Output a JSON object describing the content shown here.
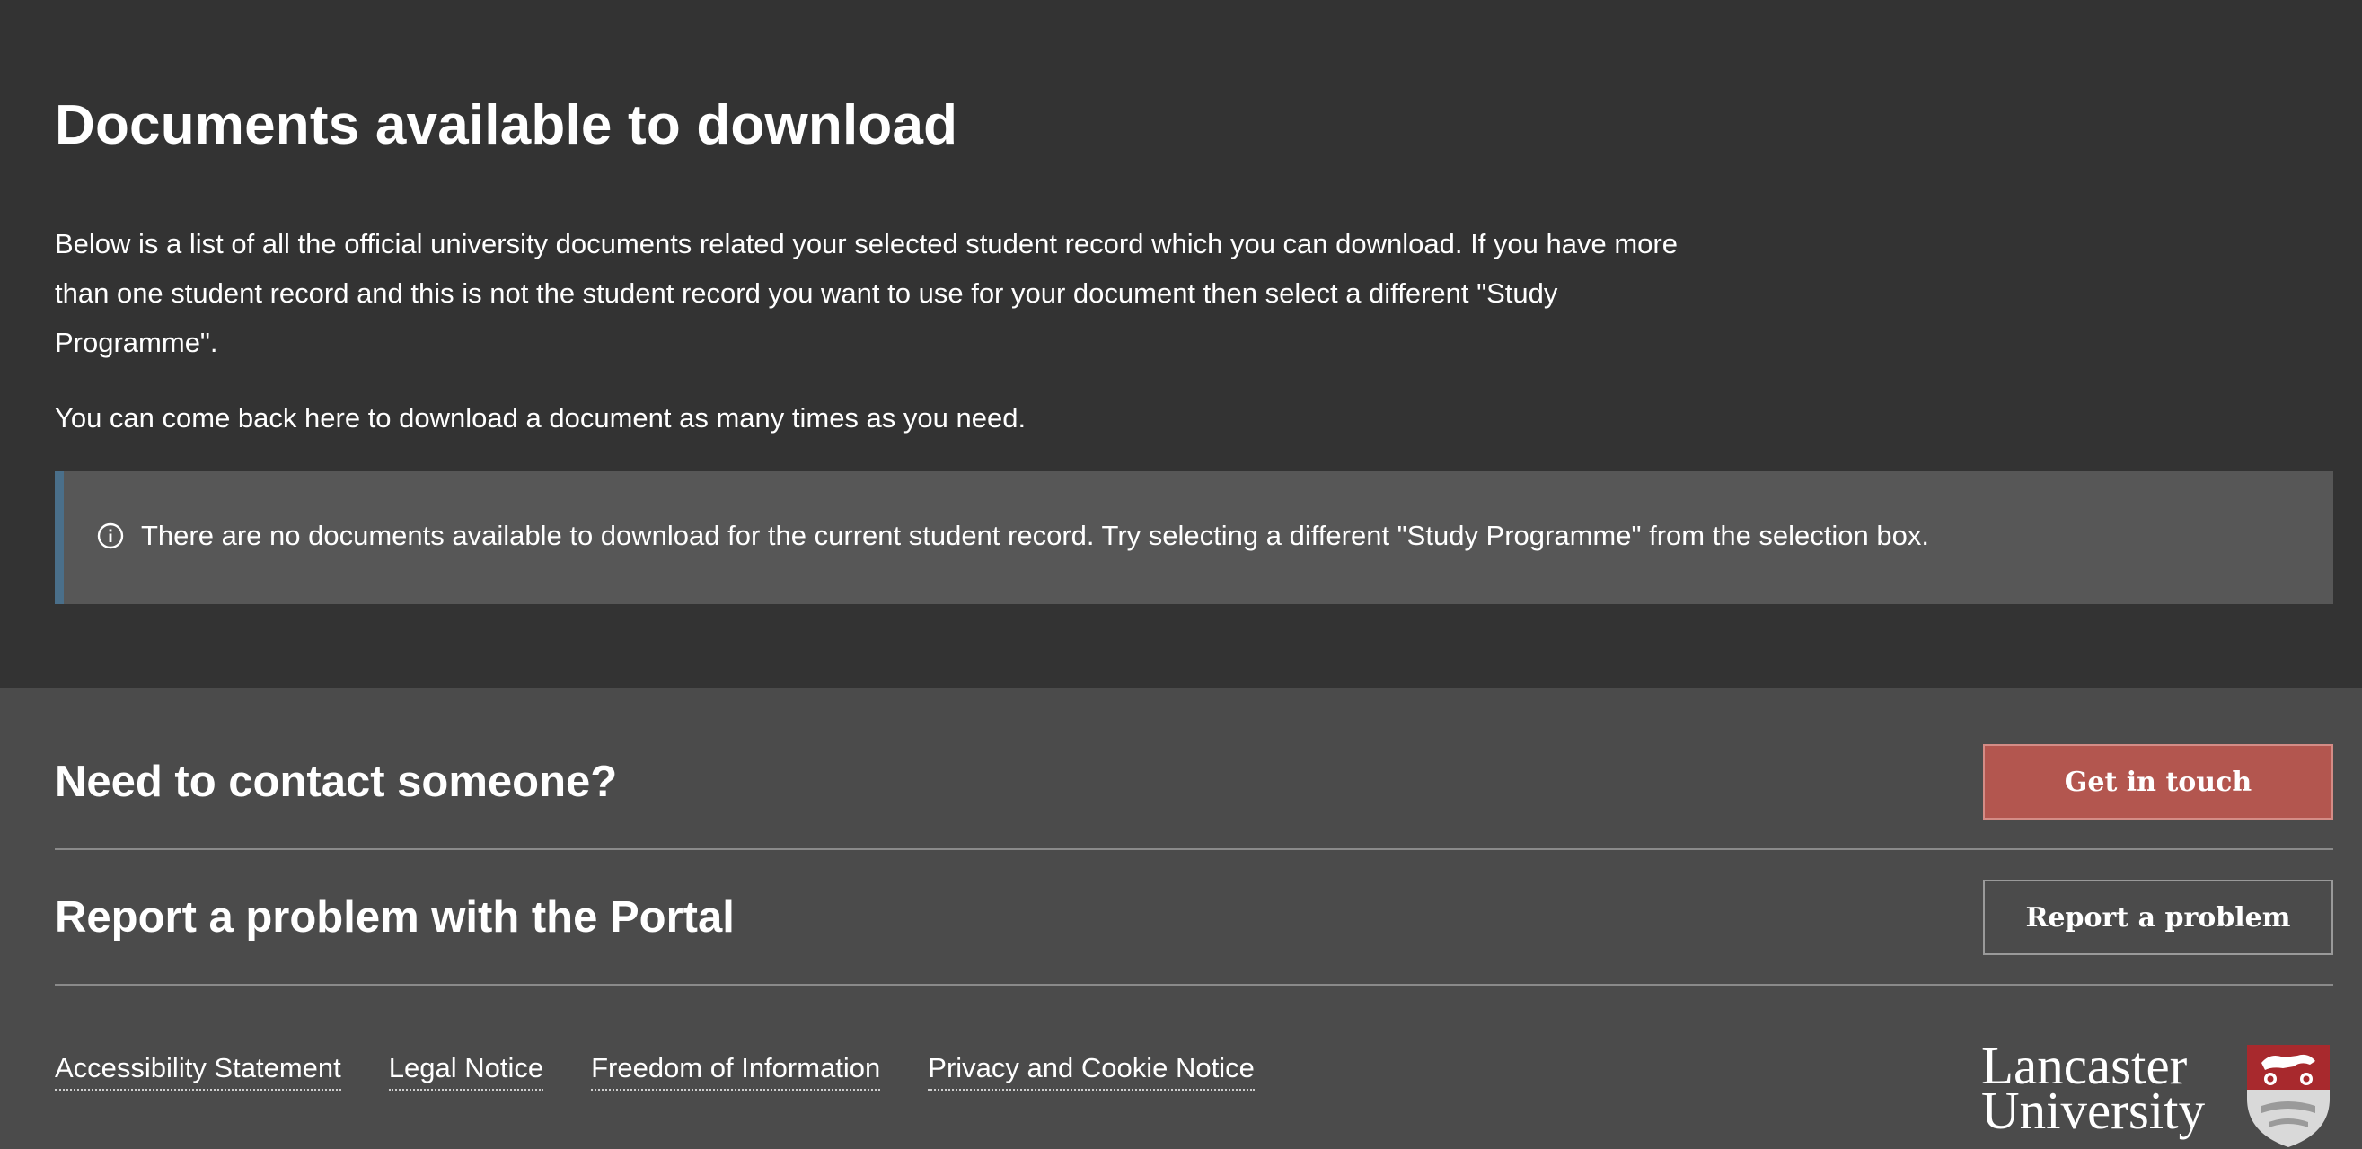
{
  "main": {
    "title": "Documents available to download",
    "intro": "Below is a list of all the official university documents related your selected student record which you can download. If you have more than one student record and this is not the student record you want to use for your document then select a different \"Study Programme\".",
    "intro_2": "You can come back here to download a document as many times as you need.",
    "alert": {
      "icon": "info-icon",
      "text": "There are no documents available to download for the current student record. Try selecting a different \"Study Programme\" from the selection box."
    }
  },
  "footer": {
    "contact": {
      "title": "Need to contact someone?",
      "button_label": "Get in touch"
    },
    "report": {
      "title": "Report a problem with the Portal",
      "button_label": "Report a problem"
    },
    "links": [
      "Accessibility Statement",
      "Legal Notice",
      "Freedom of Information",
      "Privacy and Cookie Notice"
    ],
    "logo": {
      "line1": "Lancaster",
      "line2": "University"
    }
  },
  "colors": {
    "page_background": "#333333",
    "footer_background": "#4b4b4b",
    "alert_background": "#575757",
    "alert_border": "#4a6f8a",
    "primary_button": "#b3564f",
    "crest_red": "#a8292d"
  }
}
